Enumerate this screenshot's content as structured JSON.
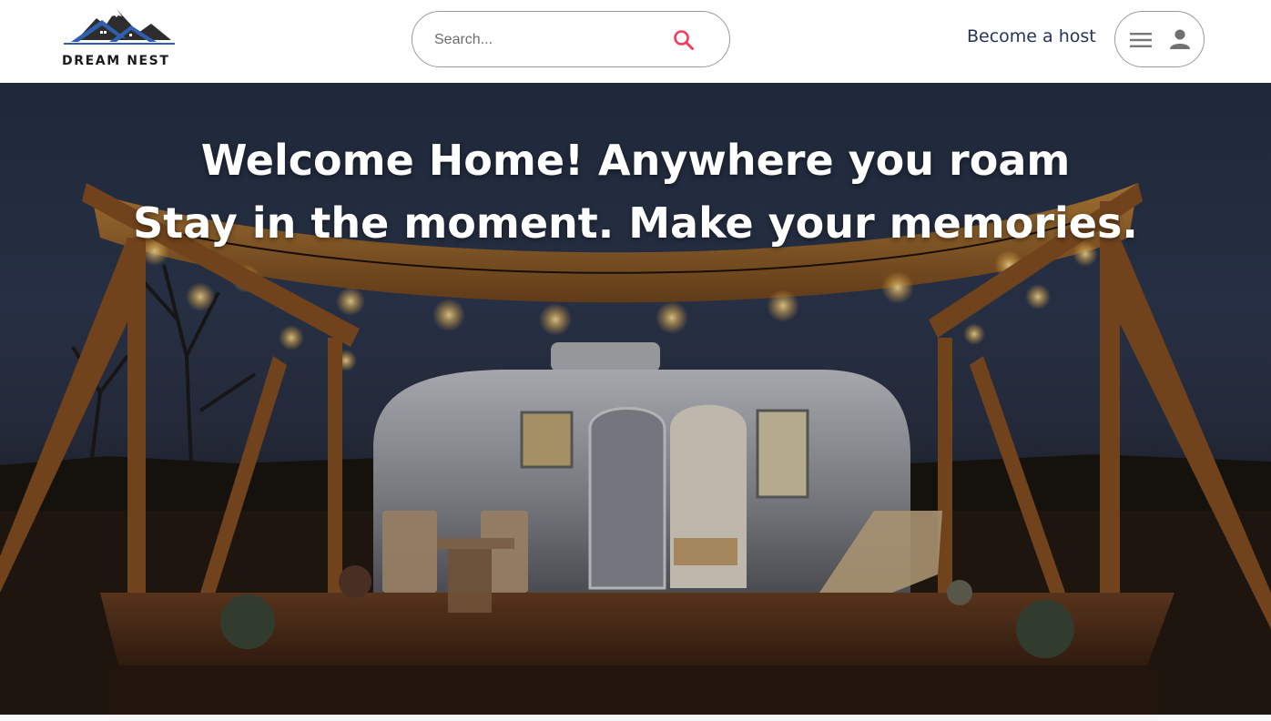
{
  "header": {
    "brand": "DREAM NEST",
    "search": {
      "placeholder": "Search..."
    },
    "become_host": "Become a host",
    "icons": {
      "logo": "mountain-house-logo",
      "search": "search-icon",
      "menu": "menu-icon",
      "account": "person-icon"
    }
  },
  "hero": {
    "line_1": "Welcome Home! Anywhere you roam",
    "line_2": "Stay in the moment. Make your memories."
  },
  "colors": {
    "accent": "#f8395a",
    "host_link": "#24355a",
    "logo_blue": "#2f5fae",
    "logo_dark": "#2d2d2d"
  }
}
